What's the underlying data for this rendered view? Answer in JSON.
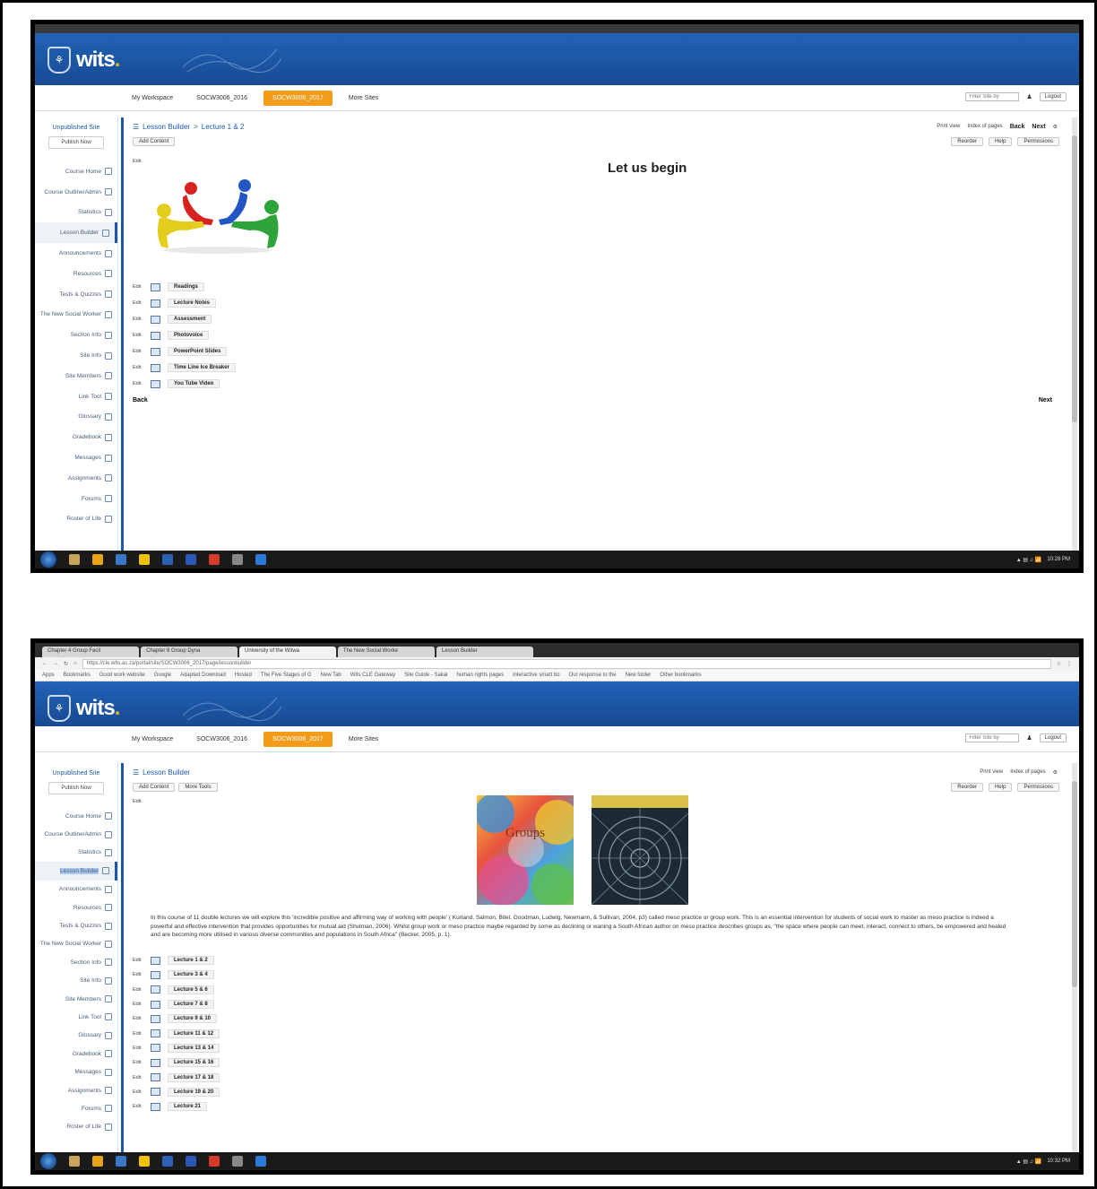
{
  "site": {
    "logo": "wits",
    "top_nav": [
      "My Workspace",
      "SOCW3006_2016",
      "SOCW3006_2017",
      "More Sites"
    ],
    "search_placeholder": "Filter Site by",
    "logout": "Logout"
  },
  "sidebar": {
    "title": "Unpublished Site",
    "publish_button": "Publish Now",
    "items": [
      "Course Home",
      "Course Outline/Admin",
      "Statistics",
      "Lesson Builder",
      "Announcements",
      "Resources",
      "Tests & Quizzes",
      "The New Social Worker",
      "Section Info",
      "Site Info",
      "Site Members",
      "Link Tool",
      "Glossary",
      "Gradebook",
      "Messages",
      "Assignments",
      "Forums",
      "Roster of Life"
    ]
  },
  "screen1": {
    "breadcrumb_root": "Lesson Builder",
    "breadcrumb_separator": ">",
    "breadcrumb_current": "Lecture 1 & 2",
    "right_links": [
      "Print view",
      "Index of pages"
    ],
    "back_top": "Back",
    "next_top": "Next",
    "toolbar": [
      "Add Content"
    ],
    "toolbar_right": [
      "Reorder",
      "Help",
      "Permissions"
    ],
    "edit_label": "Edit",
    "heading": "Let us begin",
    "links": [
      "Readings",
      "Lecture Notes",
      "Assessment",
      "Photovoice",
      "PowerPoint Slides",
      "Time Line Ice Breaker",
      "You Tube Video"
    ],
    "back_bottom": "Back",
    "next_bottom": "Next"
  },
  "screen2": {
    "tabs": [
      "Chapter 4 Group Facil",
      "Chapter 8 Group Dyna",
      "University of the Witwa",
      "The New Social Worke",
      "Lesson Builder"
    ],
    "url": "https://cle.wits.ac.za/portal/site/SOCW3006_2017/page/lessonbuilder",
    "bookmarks": [
      "Apps",
      "Bookmarks",
      "Good work website",
      "Google",
      "Adapted Download",
      "Hosted",
      "The Five Stages of G",
      "New Tab",
      "Wits CLE Gateway",
      "Site Guide - Sakai",
      "human rights pages",
      "interactive smart bo",
      "Our response to the",
      "New folder",
      "Other bookmarks"
    ],
    "breadcrumb": "Lesson Builder",
    "right_links": [
      "Print view",
      "Index of pages"
    ],
    "toolbar": [
      "Add Content",
      "More Tools"
    ],
    "toolbar_right": [
      "Reorder",
      "Help",
      "Permissions"
    ],
    "edit_label": "Edit",
    "book1_title": "Groups",
    "intro": "In this course of 11 double lectures we will explore this 'incredible positive and affirming way of working with people' ( Kurland, Salmon, Bitel, Goodman, Ludwig, Newmann, & Sullivan, 2004, p3) called meso practice or group work. This is an essential intervention for students of social work to master as meso practice is indeed a powerful and effective intervention that provides opportunities for mutual aid (Shulman, 2006). Whilst group work or meso practice maybe regarded by some as declining or waning a South African author on meso practice describes groups as, \"the space where people can meet, interact, connect to others, be empowered and healed and are becoming more utilised in various diverse communities and populations in South Africa\" (Becker, 2005, p. 1).",
    "lectures": [
      "Lecture 1 & 2",
      "Lecture 3 & 4",
      "Lecture 5 & 6",
      "Lecture 7 & 8",
      "Lecture 9 & 10",
      "Lecture 11 & 12",
      "Lecture 13 & 14",
      "Lecture 15 & 16",
      "Lecture 17 & 18",
      "Lecture 19 & 20",
      "Lecture 21"
    ]
  },
  "taskbar": {
    "time1": "10:28 PM",
    "time2": "10:32 PM"
  },
  "colors": {
    "header_blue": "#1c57a8",
    "accent_orange": "#f29c1a",
    "taskbar": "#1a1a1a"
  }
}
